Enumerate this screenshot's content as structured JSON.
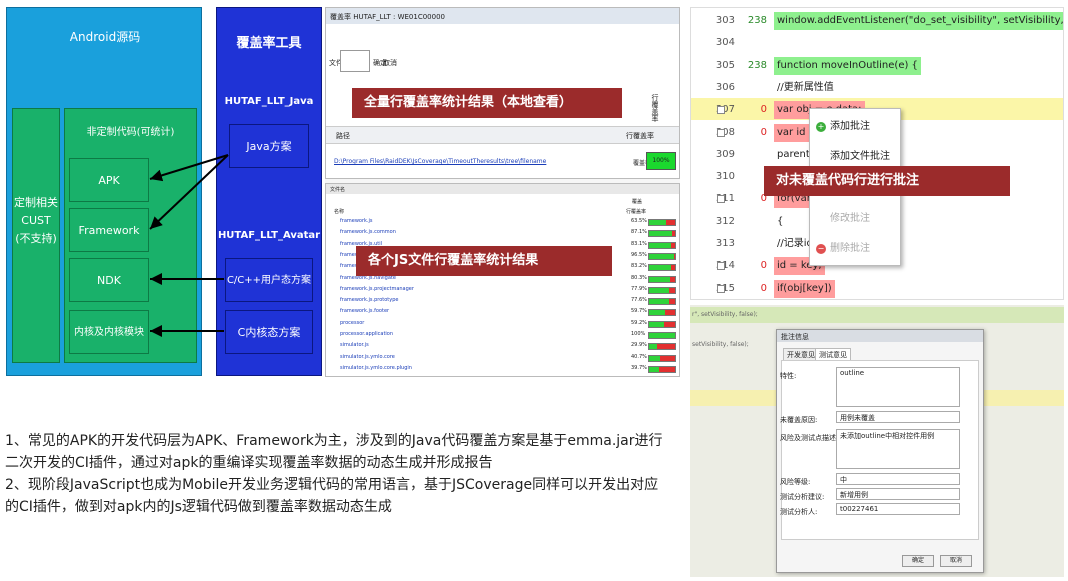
{
  "arch": {
    "android_source": "Android源码",
    "custom": "定制相关\nCUST\n(不支持)",
    "nonCustom": "非定制代码(可统计)",
    "apk": "APK",
    "framework": "Framework",
    "ndk": "NDK",
    "kernel": "内核及内核模块",
    "toolsTitle": "覆盖率工具",
    "javaTool": "HUTAF_LLT_Java",
    "javaPlan": "Java方案",
    "avatarTool": "HUTAF_LLT_Avatar",
    "userPlan": "C/C++用户态方案",
    "kernelPlan": "C内核态方案"
  },
  "report": {
    "top_title": "覆盖率  HUTAF_LLT : WE01C00000",
    "file_label": "文件名",
    "ok": "确定",
    "cancel": "取消",
    "banner1": "全量行覆盖率统计结果（本地查看）",
    "col_path": "路径",
    "col_cov": "行覆盖率",
    "path_value": "D:\\Program Files\\RaidDEK\\JsCoverage\\TimeoutTheresults\\tree\\filename",
    "cov_label": "覆盖率",
    "cov_value": "100%",
    "banner2": "各个JS文件行覆盖率统计结果",
    "sub_cov": "覆盖",
    "sub_name": "名称",
    "sub_ratio": "行覆盖率",
    "files": [
      {
        "n": "framework.js",
        "v": "63.5%"
      },
      {
        "n": "framework.js.common",
        "v": "87.1%"
      },
      {
        "n": "framework.js.util",
        "v": "83.1%"
      },
      {
        "n": "framework.js.ui",
        "v": "96.5%"
      },
      {
        "n": "framework.js.app",
        "v": "83.2%"
      },
      {
        "n": "framework.js.navigate",
        "v": "80.3%"
      },
      {
        "n": "framework.js.projectmanager",
        "v": "77.9%"
      },
      {
        "n": "framework.js.prototype",
        "v": "77.6%"
      },
      {
        "n": "framework.js.footer",
        "v": "59.7%"
      },
      {
        "n": "processor",
        "v": "59.2%"
      },
      {
        "n": "processor.application",
        "v": "100%"
      },
      {
        "n": "simulator.js",
        "v": "29.9%"
      },
      {
        "n": "simulator.js.ymlo.core",
        "v": "40.7%"
      },
      {
        "n": "simulator.js.ymlo.core.plugin",
        "v": "39.7%"
      }
    ]
  },
  "code": {
    "lines": [
      {
        "n": "303",
        "h": "238",
        "c": "window.addEventListener(\"do_set_visibility\", setVisibility, false);",
        "cls": "g"
      },
      {
        "n": "304",
        "h": "",
        "c": "",
        "cls": ""
      },
      {
        "n": "305",
        "h": "238",
        "c": "function moveInOutline(e) {",
        "cls": "g"
      },
      {
        "n": "306",
        "h": "",
        "c": "//更新属性值",
        "cls": ""
      },
      {
        "n": "307",
        "h": "0",
        "c": "var obj = e.data;",
        "cls": "r"
      },
      {
        "n": "308",
        "h": "0",
        "c": "var id = ...",
        "cls": "r"
      },
      {
        "n": "309",
        "h": "",
        "c": "parentI...",
        "cls": ""
      },
      {
        "n": "310",
        "h": "",
        "c": "",
        "cls": ""
      },
      {
        "n": "311",
        "h": "0",
        "c": "for(var i...",
        "cls": "r"
      },
      {
        "n": "312",
        "h": "",
        "c": "{",
        "cls": ""
      },
      {
        "n": "313",
        "h": "",
        "c": "//记录id...",
        "cls": ""
      },
      {
        "n": "314",
        "h": "0",
        "c": "id = key;",
        "cls": "r"
      },
      {
        "n": "315",
        "h": "0",
        "c": "if(obj[key])",
        "cls": "r"
      }
    ],
    "menu": [
      "添加批注",
      "添加文件批注",
      "修改批注",
      "删除批注"
    ],
    "banner": "对未覆盖代码行进行批注"
  },
  "dialog": {
    "bg1": "r\", setVisibility, false);",
    "bg2": "setVisibility, false);",
    "title": "批注信息",
    "tab1": "开发意见",
    "tab2": "测试意见",
    "f1": "特性:",
    "v1": "outline",
    "f2": "未覆盖原因:",
    "v2": "用例未覆盖",
    "f3": "风险及测试点描述:",
    "v3": "未添加outline中相对控件用例",
    "f4": "风险等级:",
    "v4": "中",
    "f5": "测试分析建议:",
    "v5": "新增用例",
    "f6": "测试分析人:",
    "v6": "t00227461",
    "ok": "确定",
    "cancel": "取消"
  },
  "desc": {
    "p1": "1、常见的APK的开发代码层为APK、Framework为主，涉及到的Java代码覆盖方案是基于emma.jar进行二次开发的CI插件，通过对apk的重编译实现覆盖率数据的动态生成并形成报告",
    "p2": "2、现阶段JavaScript也成为Mobile开发业务逻辑代码的常用语言，基于JSCoverage同样可以开发出对应的CI插件，做到对apk内的Js逻辑代码做到覆盖率数据动态生成"
  }
}
